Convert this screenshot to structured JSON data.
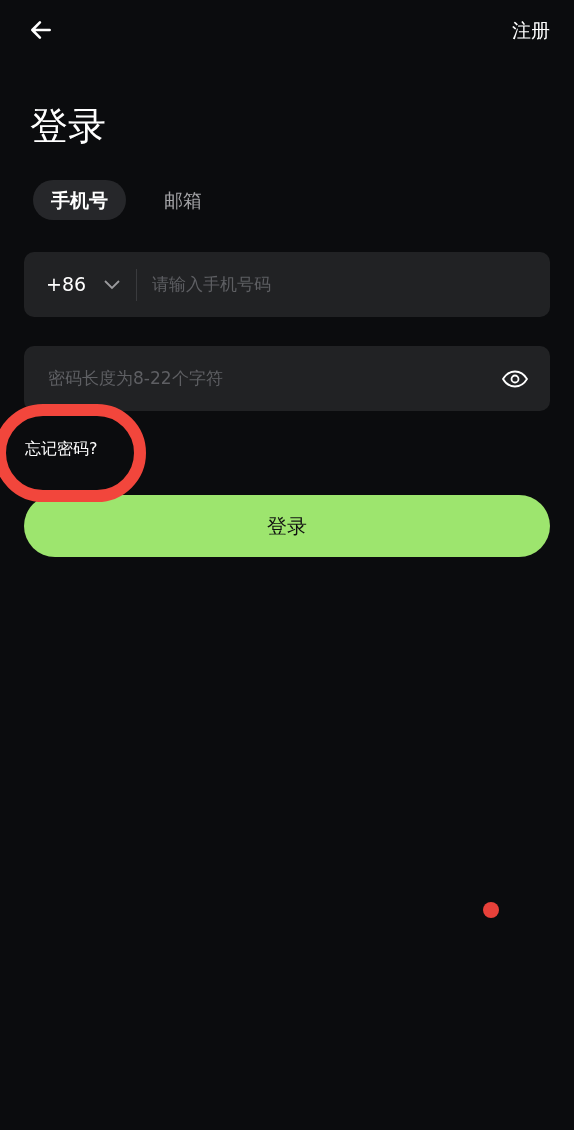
{
  "header": {
    "register_link": "注册"
  },
  "title": "登录",
  "tabs": [
    {
      "label": "手机号",
      "selected": true
    },
    {
      "label": "邮箱",
      "selected": false
    }
  ],
  "phone_field": {
    "country_code": "+86",
    "placeholder": "请输入手机号码"
  },
  "password_field": {
    "placeholder": "密码长度为8-22个字符"
  },
  "forgot_password_link": "忘记密码?",
  "login_button": "登录"
}
